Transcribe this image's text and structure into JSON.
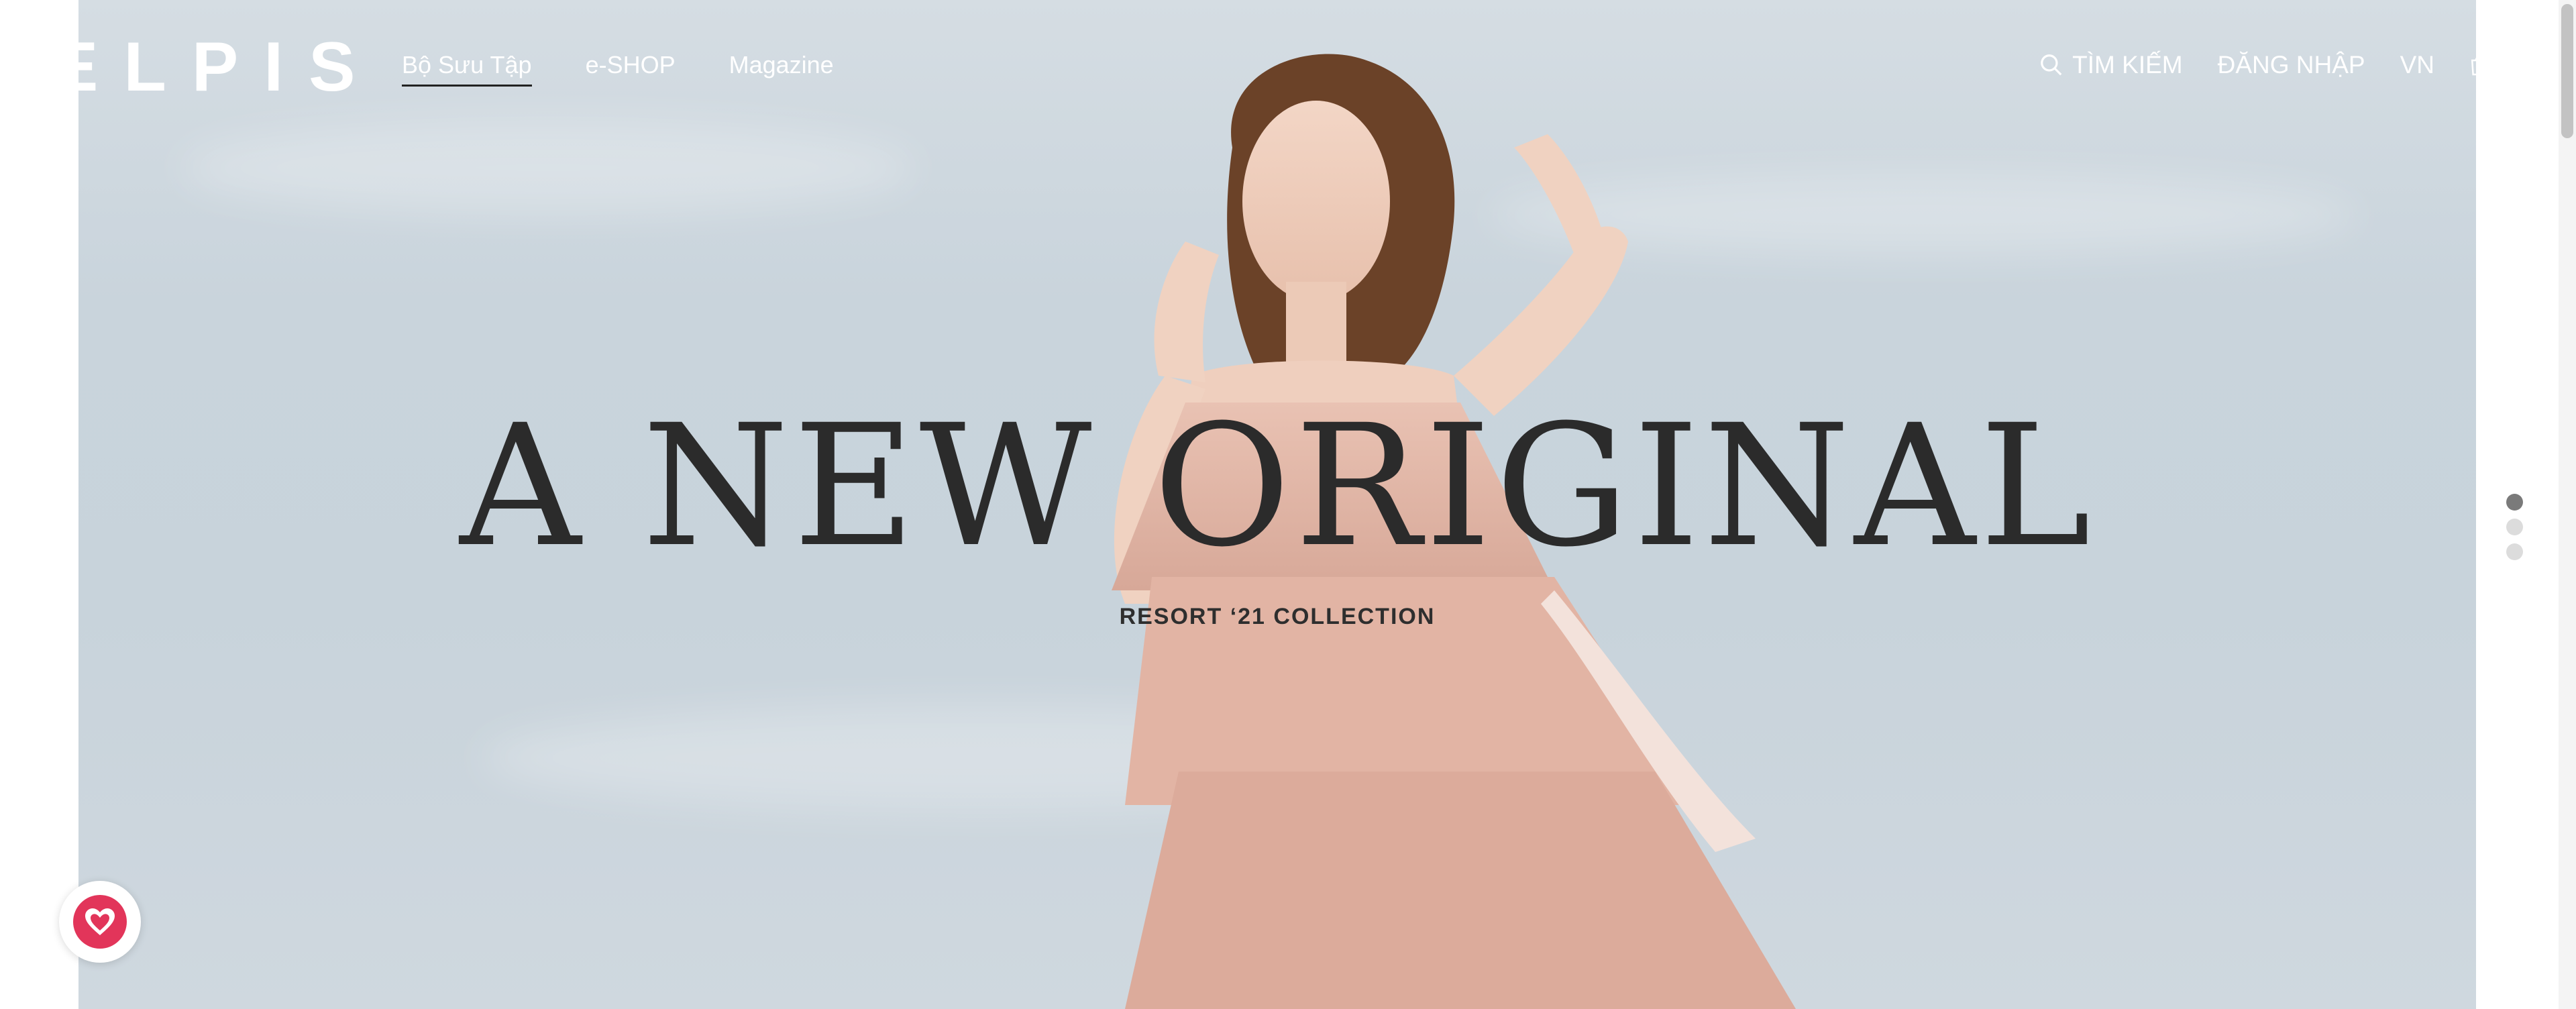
{
  "brand": {
    "logo": "ELPIS"
  },
  "nav": {
    "items": [
      {
        "label": "Bộ Sưu Tập",
        "active": true
      },
      {
        "label": "e-SHOP",
        "active": false
      },
      {
        "label": "Magazine",
        "active": false
      }
    ]
  },
  "header_right": {
    "search_label": "TÌM KIẾM",
    "login_label": "ĐĂNG NHẬP",
    "language": "VN",
    "icons": [
      "search-icon",
      "cart-icon"
    ]
  },
  "hero": {
    "headline": "A NEW ORIGINAL",
    "subheadline": "RESORT ‘21 COLLECTION",
    "slides_total": 3,
    "active_slide": 1
  },
  "floating": {
    "favorite_icon": "heart-icon"
  },
  "colors": {
    "accent": "#e2355a",
    "headline": "#2b2b2b",
    "nav_text": "#ffffff"
  }
}
